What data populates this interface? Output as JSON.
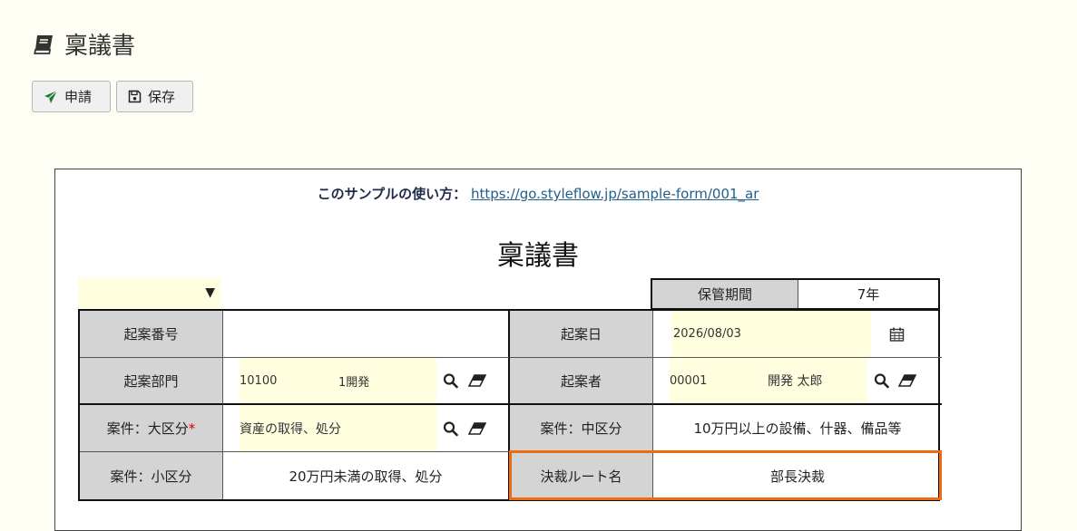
{
  "page": {
    "title": "稟議書"
  },
  "toolbar": {
    "apply_label": "申請",
    "save_label": "保存"
  },
  "howto": {
    "label": "このサンプルの使い方：",
    "link": "https://go.styleflow.jp/sample-form/001_ar"
  },
  "form": {
    "title": "稟議書",
    "retention": {
      "label": "保管期間",
      "value": "7年"
    },
    "fields": {
      "draft_no_label": "起案番号",
      "draft_no_value": "",
      "draft_date_label": "起案日",
      "draft_date_value": "2026/08/03",
      "dept_label": "起案部門",
      "dept_code": "10100",
      "dept_name": "1開発",
      "drafter_label": "起案者",
      "drafter_code": "00001",
      "drafter_name": "開発 太郎",
      "major_label": "案件：大区分",
      "major_required": "*",
      "major_value": "資産の取得、処分",
      "middle_label": "案件：中区分",
      "middle_value": "10万円以上の設備、什器、備品等",
      "minor_label": "案件：小区分",
      "minor_value": "20万円未満の取得、処分",
      "route_label": "決裁ルート名",
      "route_value": "部長決裁"
    }
  },
  "colors": {
    "input_bg": "#ffffe0",
    "label_bg": "#d4d4d4",
    "highlight": "#f06a12",
    "apply_icon": "#1e7b34"
  },
  "icons": [
    "book-icon",
    "paper-plane-icon",
    "floppy-disk-icon",
    "dropdown-arrow-icon",
    "calendar-icon",
    "search-icon",
    "eraser-icon"
  ]
}
